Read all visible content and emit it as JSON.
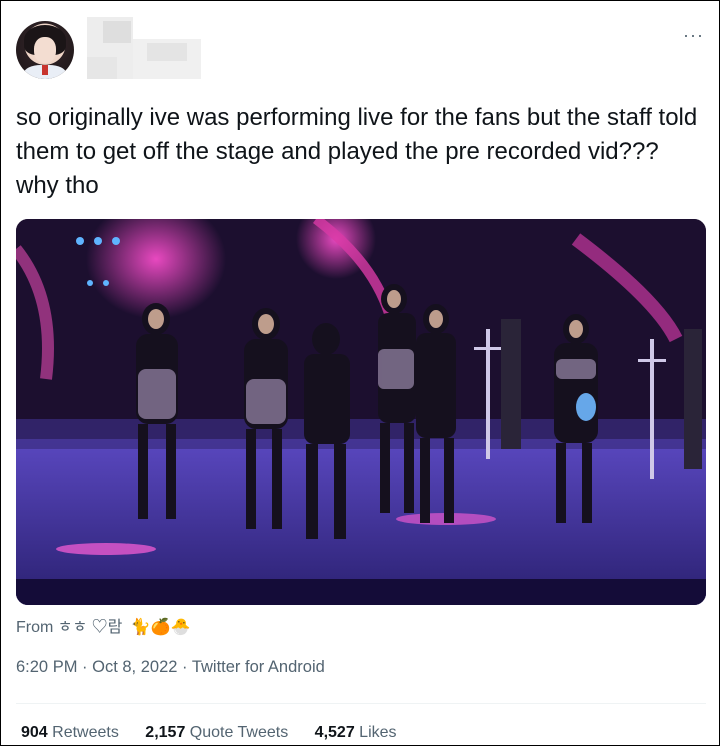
{
  "tweet": {
    "text": "so originally ive was performing live for the fans but the staff told them to get off the stage and played the pre recorded vid??? why tho",
    "more_label": "···"
  },
  "source": {
    "prefix": "From ",
    "name": "ㅎㅎ ♡람 ",
    "emojis": "🐈🍊🐣"
  },
  "meta": {
    "time": "6:20 PM",
    "separator1": " · ",
    "date": "Oct 8, 2022",
    "separator2": " · ",
    "client": "Twitter for Android"
  },
  "stats": [
    {
      "count": "904",
      "label": " Retweets"
    },
    {
      "count": "2,157",
      "label": " Quote Tweets"
    },
    {
      "count": "4,527",
      "label": " Likes"
    }
  ],
  "colors": {
    "text_primary": "#0f1419",
    "text_secondary": "#536471",
    "stage_purple": "#4b3aa8",
    "stage_pink": "#e23fb5"
  }
}
